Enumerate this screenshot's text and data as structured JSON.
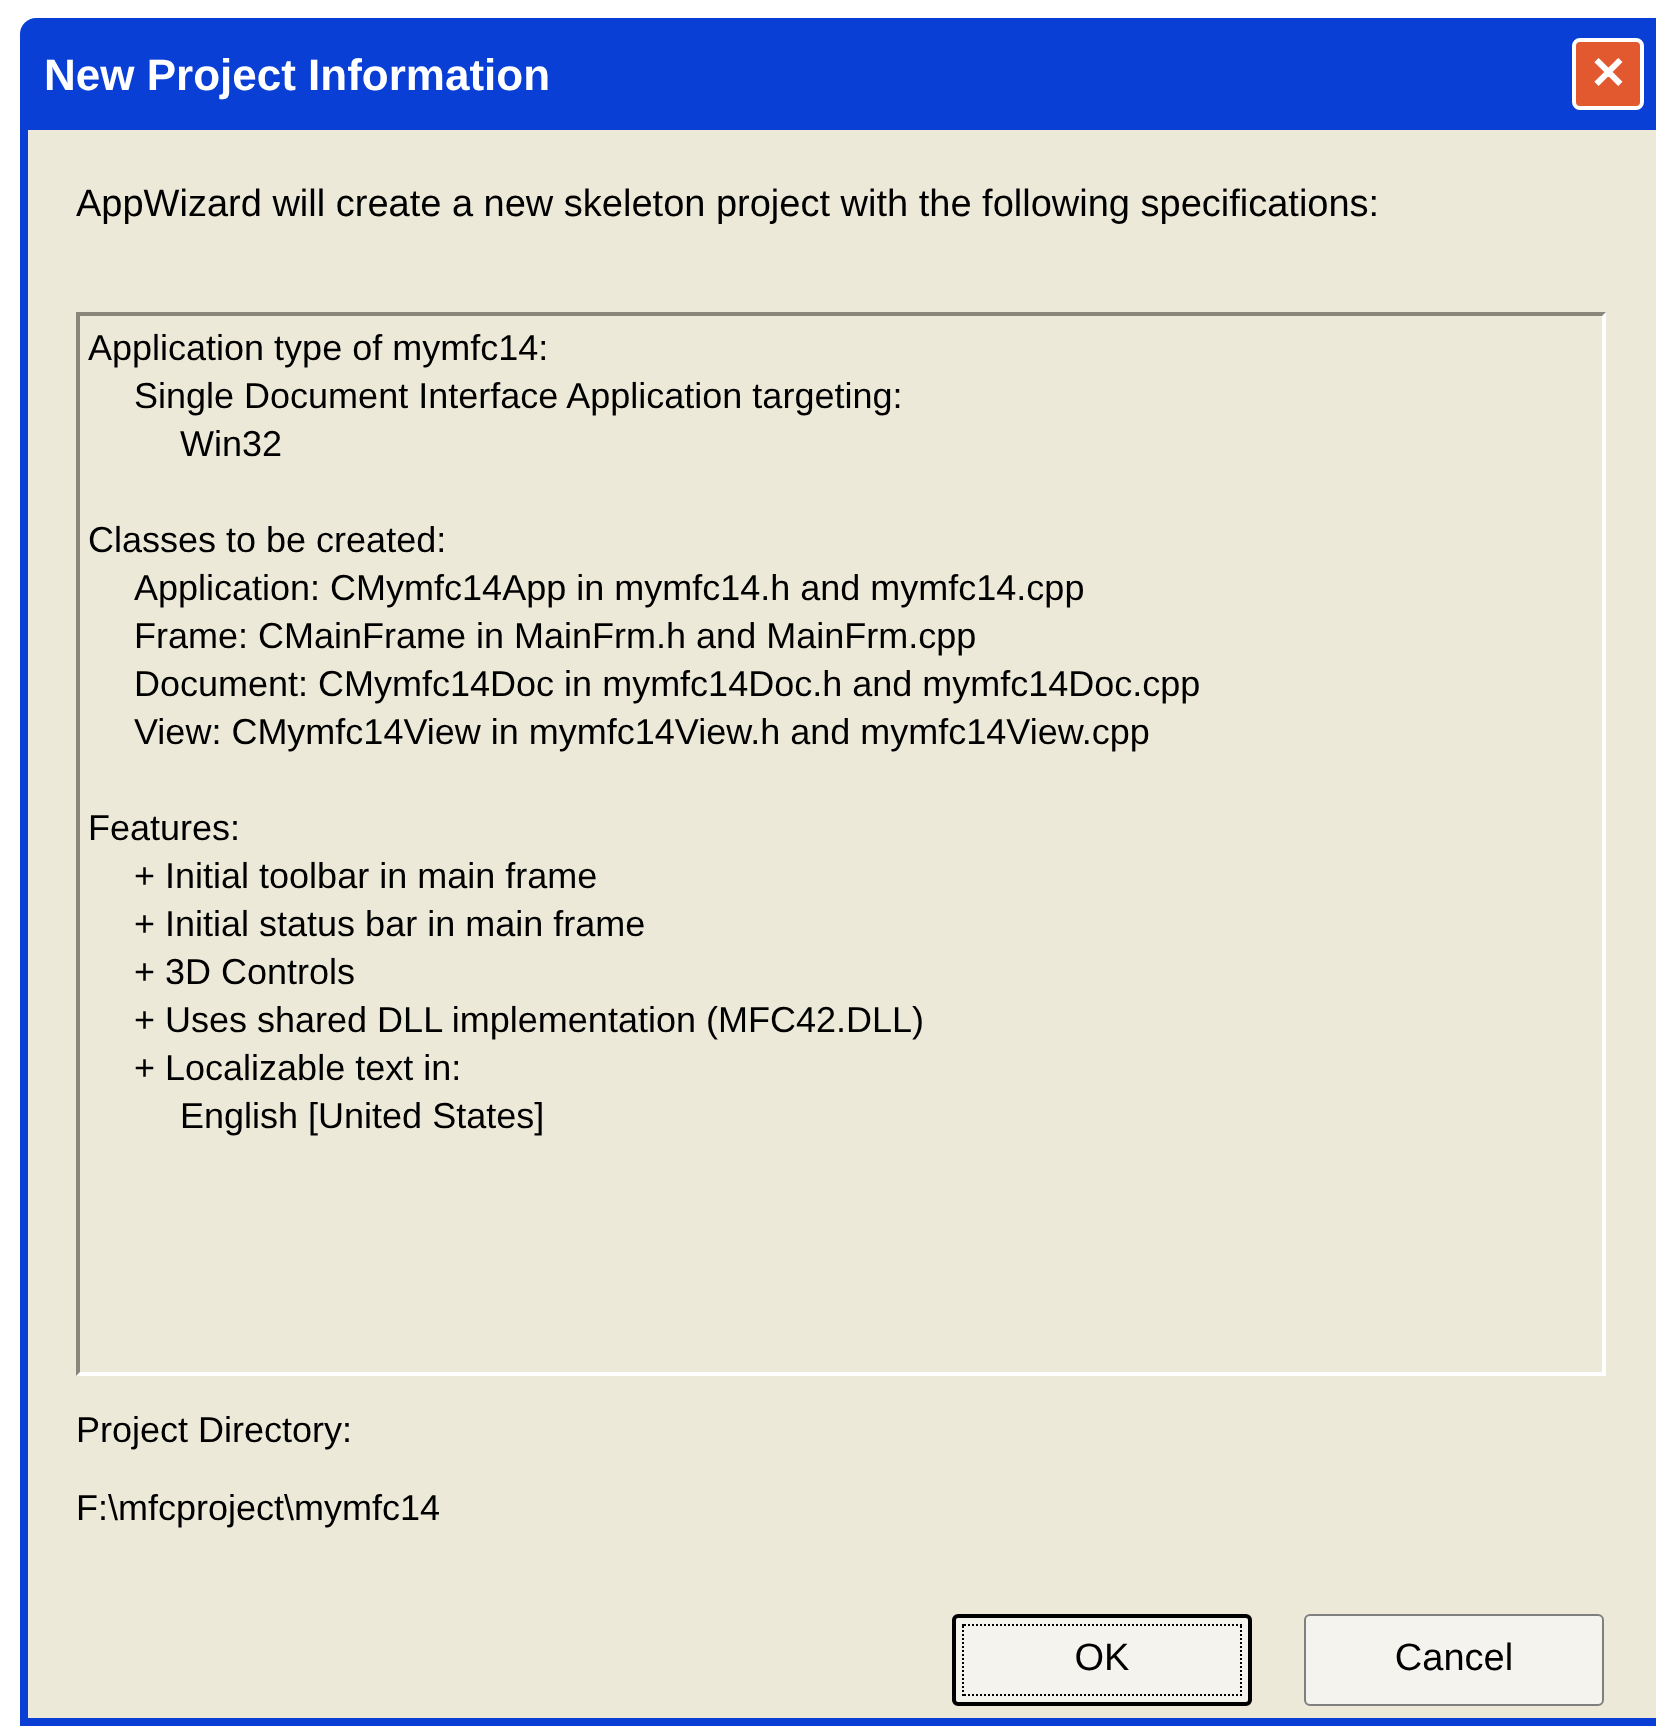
{
  "window": {
    "title": "New Project Information",
    "close": "✕"
  },
  "intro": "AppWizard will create a new skeleton project with the following specifications:",
  "summary": [
    {
      "text": "Application type of mymfc14:",
      "children": [
        {
          "text": "Single Document Interface Application targeting:",
          "children": [
            {
              "text": "Win32"
            }
          ]
        }
      ]
    },
    {
      "text": "Classes to be created:",
      "children": [
        {
          "text": "Application: CMymfc14App in mymfc14.h and mymfc14.cpp"
        },
        {
          "text": "Frame: CMainFrame in MainFrm.h and MainFrm.cpp"
        },
        {
          "text": "Document: CMymfc14Doc in mymfc14Doc.h and mymfc14Doc.cpp"
        },
        {
          "text": "View: CMymfc14View in mymfc14View.h and mymfc14View.cpp"
        }
      ]
    },
    {
      "text": "Features:",
      "children": [
        {
          "text": "+ Initial toolbar in main frame"
        },
        {
          "text": "+ Initial status bar in main frame"
        },
        {
          "text": "+ 3D Controls"
        },
        {
          "text": "+ Uses shared DLL implementation (MFC42.DLL)"
        },
        {
          "text": "+ Localizable text in:",
          "children": [
            {
              "text": "English [United States]"
            }
          ]
        }
      ]
    }
  ],
  "project_directory": {
    "label": "Project Directory:",
    "value": "F:\\mfcproject\\mymfc14"
  },
  "buttons": [
    {
      "label": "OK",
      "default": true
    },
    {
      "label": "Cancel",
      "default": false
    }
  ]
}
